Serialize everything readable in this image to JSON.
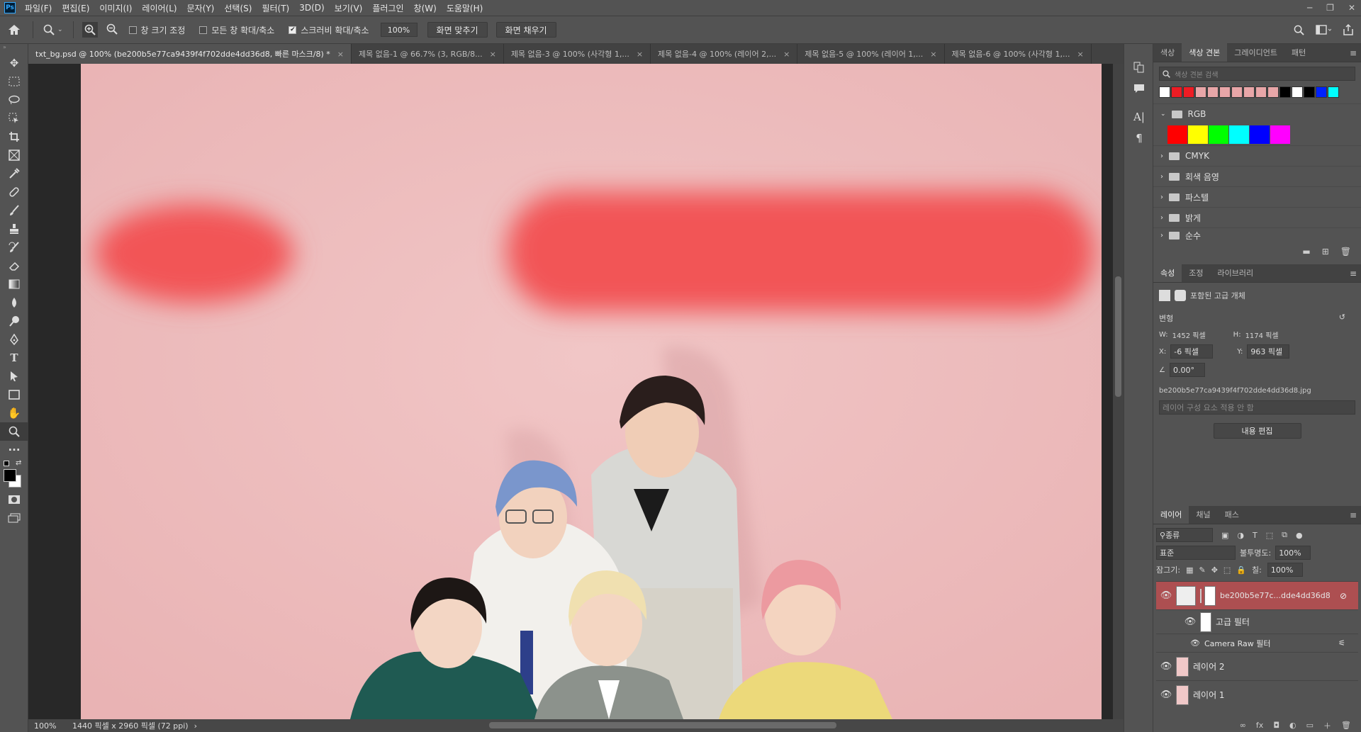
{
  "app": {
    "logo": "Ps"
  },
  "menu": [
    "파일(F)",
    "편집(E)",
    "이미지(I)",
    "레이어(L)",
    "문자(Y)",
    "선택(S)",
    "필터(T)",
    "3D(D)",
    "보기(V)",
    "플러그인",
    "창(W)",
    "도움말(H)"
  ],
  "window_controls": {
    "minimize": "─",
    "restore": "❐",
    "close": "✕"
  },
  "options": {
    "resize_windows": "창 크기 조정",
    "zoom_all": "모든 창 확대/축소",
    "scrubby_zoom": "스크러비 확대/축소",
    "zoom_value": "100%",
    "fit_screen": "화면 맞추기",
    "fill_screen": "화면 채우기",
    "scrubby_checked": "✔"
  },
  "tabs": [
    {
      "label": "txt_bg.psd @ 100% (be200b5e77ca9439f4f702dde4dd36d8, 빠른 마스크/8) *",
      "close": "×"
    },
    {
      "label": "제목 없음-1 @ 66.7% (3, RGB/8...",
      "close": "×"
    },
    {
      "label": "제목 없음-3 @ 100% (사각형 1,...",
      "close": "×"
    },
    {
      "label": "제목 없음-4 @ 100% (레이어 2,...",
      "close": "×"
    },
    {
      "label": "제목 없음-5 @ 100% (레이어 1,...",
      "close": "×"
    },
    {
      "label": "제목 없음-6 @ 100% (사각형 1,...",
      "close": "×"
    }
  ],
  "status": {
    "zoom": "100%",
    "doc_info": "1440 픽셀 x 2960 픽셀 (72 ppi)",
    "arrow": "›"
  },
  "swatches_panel": {
    "tabs": [
      "색상",
      "색상 견본",
      "그레이디언트",
      "패턴"
    ],
    "search_placeholder": "색상 견본 검색",
    "recent_colors": [
      "#ffffff",
      "#ee1c24",
      "#ee1c24",
      "#e8a6a8",
      "#e8a6a8",
      "#e8a6a8",
      "#e8a6a8",
      "#e8a6a8",
      "#e8a6a8",
      "#e8a6a8",
      "#000000",
      "#ffffff",
      "#000000",
      "#0022ff",
      "#00ffff"
    ],
    "groups": [
      {
        "name": "RGB",
        "open": true,
        "colors": [
          "#ff0000",
          "#ffff00",
          "#00ff00",
          "#00ffff",
          "#0000ff",
          "#ff00ff"
        ]
      },
      {
        "name": "CMYK",
        "open": false
      },
      {
        "name": "회색 음영",
        "open": false
      },
      {
        "name": "파스텔",
        "open": false
      },
      {
        "name": "밝게",
        "open": false
      },
      {
        "name": "순수",
        "open": false
      }
    ]
  },
  "properties_panel": {
    "tabs": [
      "속성",
      "조정",
      "라이브러리"
    ],
    "type_label": "포함된 고급 개체",
    "transform_label": "변형",
    "w_label": "W:",
    "w_value": "1452 픽셀",
    "h_label": "H:",
    "h_value": "1174 픽셀",
    "x_label": "X:",
    "x_value": "-6 픽셀",
    "y_label": "Y:",
    "y_value": "963 픽셀",
    "angle_value": "0.00°",
    "filename": "be200b5e77ca9439f4f702dde4dd36d8.jpg",
    "comp_placeholder": "레이어 구성 요소 적용 안 함",
    "edit_contents": "내용 편집"
  },
  "layers_panel": {
    "tabs": [
      "레이어",
      "채널",
      "패스"
    ],
    "filter_kind": "종류",
    "blend_mode": "표준",
    "opacity_label": "불투명도:",
    "opacity_value": "100%",
    "lock_label": "잠그기:",
    "fill_label": "칠:",
    "fill_value": "100%",
    "layers": [
      {
        "name": "be200b5e77c...dde4dd36d8",
        "selected": true
      },
      {
        "name": "고급 필터",
        "sub": true
      },
      {
        "name": "Camera Raw 필터",
        "subsub": true
      },
      {
        "name": "레이어 2"
      },
      {
        "name": "레이어 1"
      }
    ],
    "footer_icons": [
      "∞",
      "fx",
      "◘",
      "◐",
      "▭",
      "＋",
      "🗑"
    ]
  },
  "colors": {
    "canvas_pink": "#eebcbd",
    "mask_red": "#f25557",
    "selected_layer": "#ad4f51"
  }
}
